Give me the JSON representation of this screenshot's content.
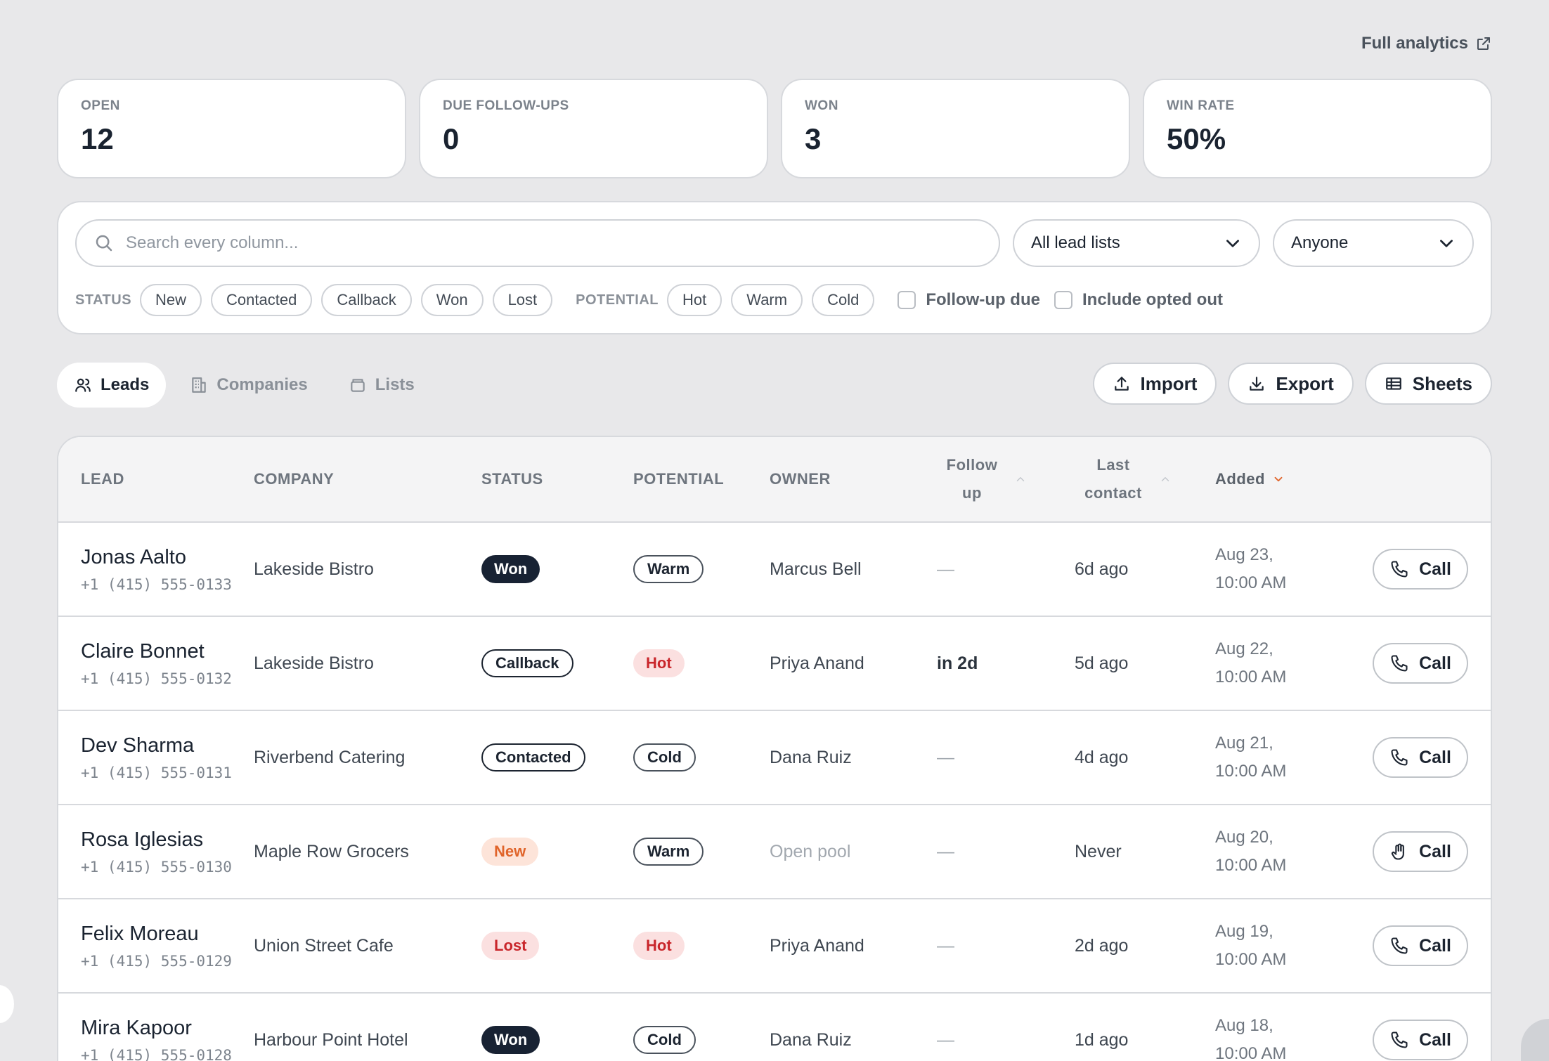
{
  "header": {
    "analytics_link": "Full analytics"
  },
  "stats": [
    {
      "label": "OPEN",
      "value": "12"
    },
    {
      "label": "DUE FOLLOW-UPS",
      "value": "0"
    },
    {
      "label": "WON",
      "value": "3"
    },
    {
      "label": "WIN RATE",
      "value": "50%"
    }
  ],
  "filters": {
    "search_placeholder": "Search every column...",
    "lead_lists": "All lead lists",
    "owner": "Anyone",
    "status_label": "STATUS",
    "status_options": [
      "New",
      "Contacted",
      "Callback",
      "Won",
      "Lost"
    ],
    "potential_label": "POTENTIAL",
    "potential_options": [
      "Hot",
      "Warm",
      "Cold"
    ],
    "followup_due": "Follow-up due",
    "include_opted_out": "Include opted out"
  },
  "tabs": [
    "Leads",
    "Companies",
    "Lists"
  ],
  "actions": {
    "import": "Import",
    "export": "Export",
    "sheets": "Sheets"
  },
  "table": {
    "headers": {
      "lead": "LEAD",
      "company": "COMPANY",
      "status": "STATUS",
      "potential": "POTENTIAL",
      "owner": "OWNER",
      "follow_1": "Follow",
      "follow_2": "up",
      "last_1": "Last",
      "last_2": "contact",
      "added": "Added"
    },
    "call_label": "Call",
    "rows": [
      {
        "name": "Jonas Aalto",
        "phone": "+1 (415) 555-0133",
        "company": "Lakeside Bistro",
        "status": "Won",
        "potential": "Warm",
        "owner": "Marcus Bell",
        "follow": "—",
        "last": "6d ago",
        "added_1": "Aug 23,",
        "added_2": "10:00 AM"
      },
      {
        "name": "Claire Bonnet",
        "phone": "+1 (415) 555-0132",
        "company": "Lakeside Bistro",
        "status": "Callback",
        "potential": "Hot",
        "owner": "Priya Anand",
        "follow": "in 2d",
        "last": "5d ago",
        "added_1": "Aug 22,",
        "added_2": "10:00 AM"
      },
      {
        "name": "Dev Sharma",
        "phone": "+1 (415) 555-0131",
        "company": "Riverbend Catering",
        "status": "Contacted",
        "potential": "Cold",
        "owner": "Dana Ruiz",
        "follow": "—",
        "last": "4d ago",
        "added_1": "Aug 21,",
        "added_2": "10:00 AM"
      },
      {
        "name": "Rosa Iglesias",
        "phone": "+1 (415) 555-0130",
        "company": "Maple Row Grocers",
        "status": "New",
        "potential": "Warm",
        "owner": "Open pool",
        "follow": "—",
        "last": "Never",
        "added_1": "Aug 20,",
        "added_2": "10:00 AM"
      },
      {
        "name": "Felix Moreau",
        "phone": "+1 (415) 555-0129",
        "company": "Union Street Cafe",
        "status": "Lost",
        "potential": "Hot",
        "owner": "Priya Anand",
        "follow": "—",
        "last": "2d ago",
        "added_1": "Aug 19,",
        "added_2": "10:00 AM"
      },
      {
        "name": "Mira Kapoor",
        "phone": "+1 (415) 555-0128",
        "company": "Harbour Point Hotel",
        "status": "Won",
        "potential": "Cold",
        "owner": "Dana Ruiz",
        "follow": "—",
        "last": "1d ago",
        "added_1": "Aug 18,",
        "added_2": "10:00 AM"
      }
    ]
  }
}
